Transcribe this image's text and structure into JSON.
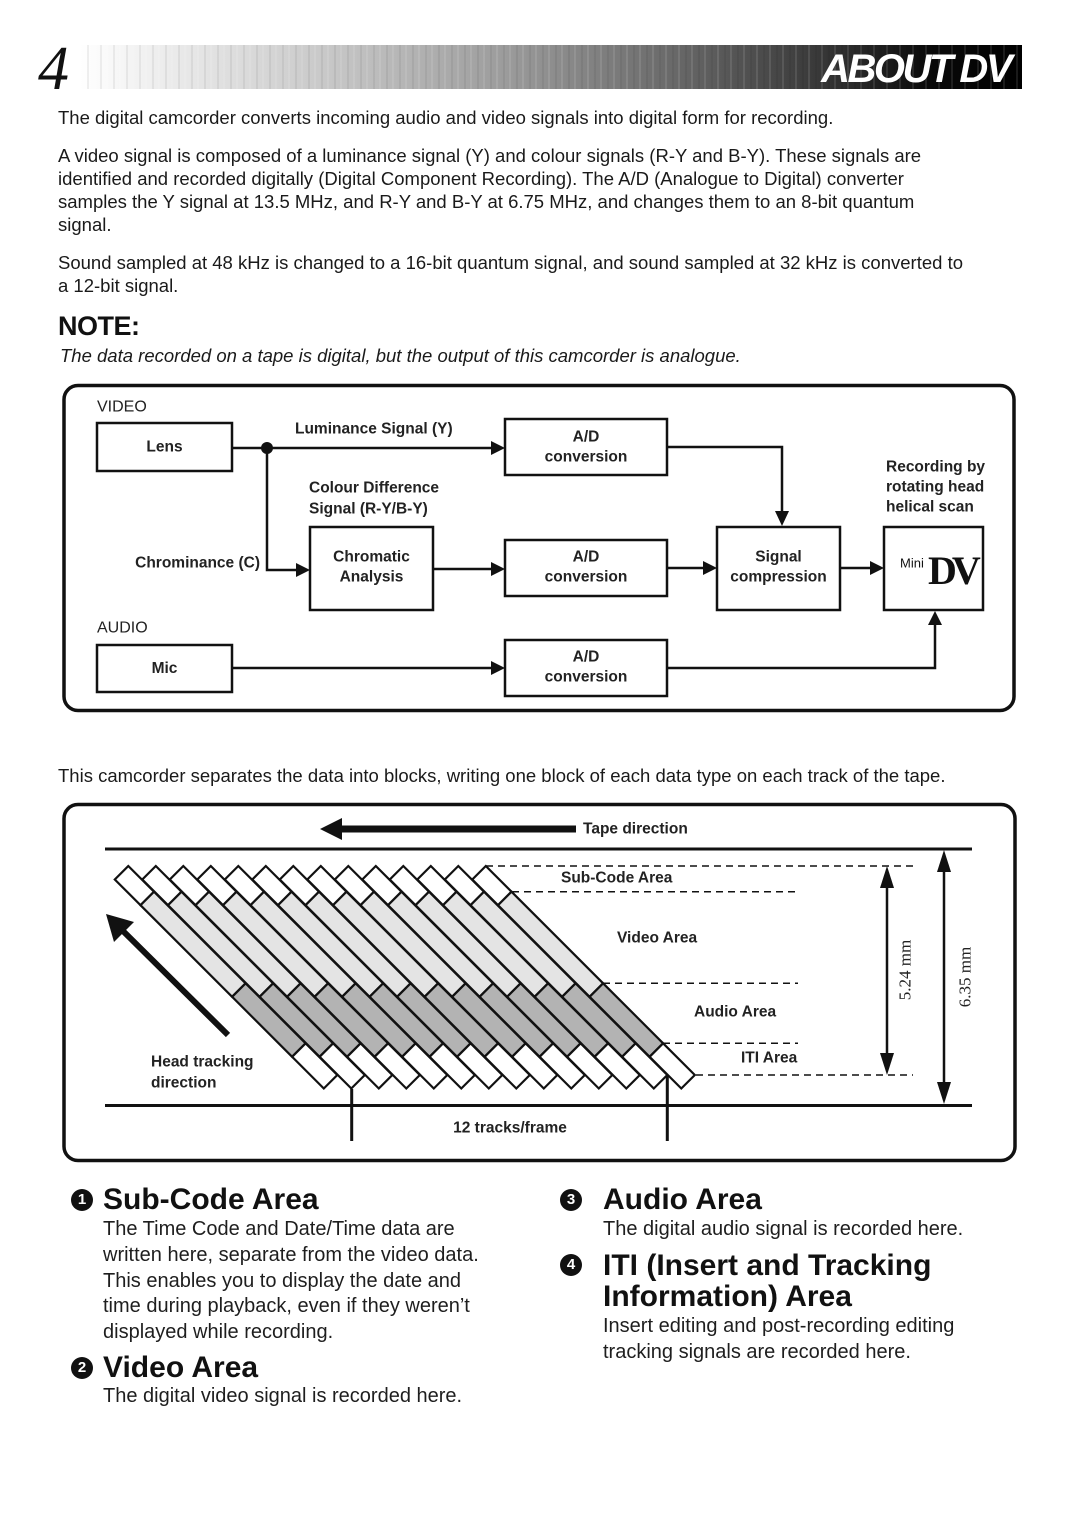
{
  "header": {
    "page_number": "4",
    "language": "EN",
    "section_title": "ABOUT DV"
  },
  "intro": {
    "paragraph_1": [
      "The digital camcorder converts incoming audio and video signals into digital form for recording."
    ],
    "paragraph_2": [
      "A video signal is composed of a luminance signal (Y) and colour signals (R-Y and B-Y). These signals are",
      "identified and recorded digitally (Digital Component Recording). The A/D (Analogue to Digital) converter",
      "samples the Y signal at 13.5 MHz, and R-Y and B-Y at 6.75 MHz, and changes them to an 8-bit quantum",
      "signal."
    ],
    "paragraph_3": [
      "Sound sampled at 48 kHz is changed to a 16-bit quantum signal, and sound sampled at 32 kHz is converted to",
      "a 12-bit signal."
    ]
  },
  "note": {
    "heading": "NOTE:",
    "text": "The data recorded on a tape is digital, but the output of this camcorder is analogue."
  },
  "signal_diagram": {
    "video_group_label": "VIDEO",
    "audio_group_label": "AUDIO",
    "lens": "Lens",
    "mic": "Mic",
    "luminance_signal": "Luminance Signal (Y)",
    "chrominance": "Chrominance (C)",
    "colour_difference": [
      "Colour Difference",
      "Signal (R-Y/B-Y)"
    ],
    "chromatic_analysis": [
      "Chromatic",
      "Analysis"
    ],
    "ad_conversion": [
      "A/D",
      "conversion"
    ],
    "signal_compression": [
      "Signal",
      "compression"
    ],
    "recording_note": [
      "Recording by",
      "rotating head",
      "helical scan"
    ],
    "tape_logo": {
      "prefix": "Mini",
      "mark": "DV"
    }
  },
  "tape_caption": "This camcorder separates the data into blocks, writing one block of each data type on each track of the tape.",
  "tape_diagram": {
    "tape_direction_label": "Tape direction",
    "head_tracking_label": [
      "Head tracking",
      "direction"
    ],
    "area_labels": {
      "sub_code": "Sub-Code Area",
      "video": "Video Area",
      "audio": "Audio Area",
      "iti": "ITI Area"
    },
    "track_height": "5.24 mm",
    "tape_width": "6.35 mm",
    "tracks_per_frame": "12 tracks/frame",
    "tracks_shown": 14,
    "area_colors": {
      "sub_code": "#ffffff",
      "video": "#e4e4e4",
      "audio": "#b3b3b3",
      "iti": "#ffffff"
    }
  },
  "sections": [
    {
      "number": "1",
      "title": [
        "Sub-Code Area"
      ],
      "body": [
        "The Time Code and Date/Time data are",
        "written here, separate from the video data.",
        "This enables you to display the date and",
        "time during playback, even if they weren’t",
        "displayed while recording."
      ]
    },
    {
      "number": "2",
      "title": [
        "Video Area"
      ],
      "body": [
        "The digital video signal is recorded here."
      ]
    },
    {
      "number": "3",
      "title": [
        "Audio Area"
      ],
      "body": [
        "The digital audio signal is recorded here."
      ]
    },
    {
      "number": "4",
      "title": [
        "ITI (Insert and Tracking",
        "Information) Area"
      ],
      "body": [
        "Insert editing and post-recording editing",
        "tracking signals are recorded here."
      ]
    }
  ]
}
